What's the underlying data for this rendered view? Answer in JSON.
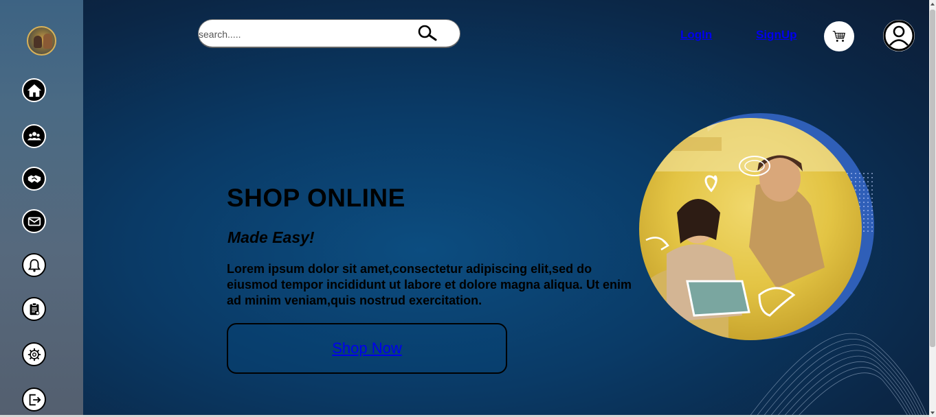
{
  "search": {
    "placeholder": "search....."
  },
  "header": {
    "login_label": "LogIn",
    "signup_label": "SignUp"
  },
  "sidebar": {
    "items": [
      {
        "icon": "home-icon"
      },
      {
        "icon": "users-group-icon"
      },
      {
        "icon": "handshake-icon"
      },
      {
        "icon": "mail-icon"
      },
      {
        "icon": "bell-icon"
      },
      {
        "icon": "clipboard-icon"
      },
      {
        "icon": "gear-icon"
      },
      {
        "icon": "logout-icon"
      }
    ]
  },
  "hero": {
    "title": "SHOP ONLINE",
    "subtitle": "Made Easy!",
    "text": "Lorem ipsum dolor sit amet,consectetur adipiscing elit,sed do eiusmod tempor incididunt ut labore et dolore magna aliqua. Ut enim ad minim veniam,quis nostrud exercitation.",
    "cta_label": "Shop Now"
  },
  "colors": {
    "link": "#0000ee",
    "accent_ring": "#2f5fb8",
    "hero_image_tone": "#e7c94a",
    "background": "#0a3a66"
  }
}
